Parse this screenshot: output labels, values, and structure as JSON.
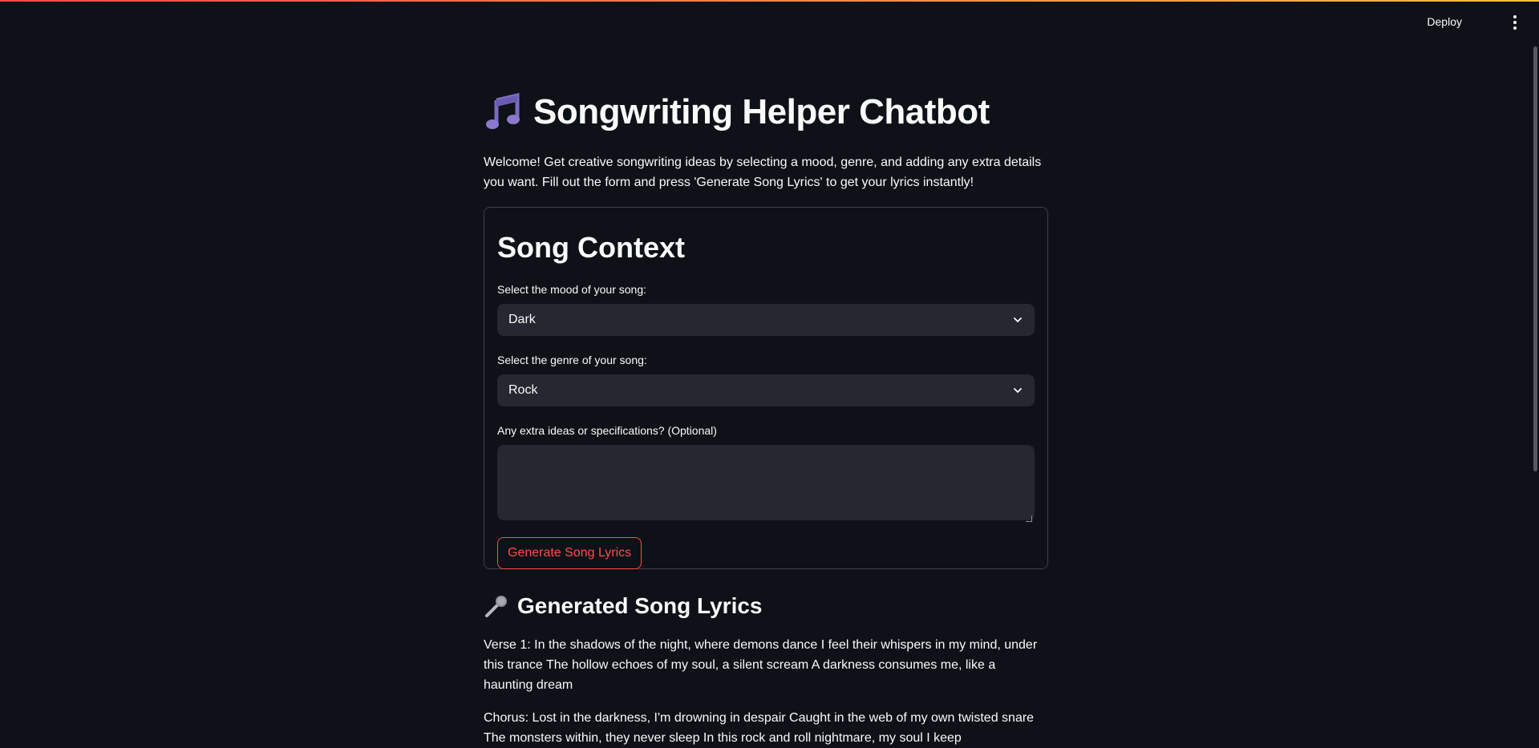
{
  "header": {
    "deploy_label": "Deploy",
    "menu_icon": "more-vert-icon"
  },
  "app": {
    "title": "Songwriting Helper Chatbot",
    "title_icon": "musical-notes-icon",
    "intro": "Welcome! Get creative songwriting ideas by selecting a mood, genre, and adding any extra details you want. Fill out the form and press 'Generate Song Lyrics' to get your lyrics instantly!"
  },
  "form": {
    "title": "Song Context",
    "mood_label": "Select the mood of your song:",
    "mood_value": "Dark",
    "genre_label": "Select the genre of your song:",
    "genre_value": "Rock",
    "extra_label": "Any extra ideas or specifications? (Optional)",
    "extra_value": "",
    "submit_label": "Generate Song Lyrics"
  },
  "lyrics": {
    "title": "Generated Song Lyrics",
    "title_icon": "microphone-icon",
    "paragraphs": [
      "Verse 1: In the shadows of the night, where demons dance I feel their whispers in my mind, under this trance The hollow echoes of my soul, a silent scream A darkness consumes me, like a haunting dream",
      "Chorus: Lost in the darkness, I'm drowning in despair Caught in the web of my own twisted snare The monsters within, they never sleep In this rock and roll nightmare, my soul I keep"
    ]
  },
  "colors": {
    "background": "#0e1117",
    "input_bg": "#262730",
    "accent": "#ff4b4b",
    "text": "#fafafa"
  }
}
